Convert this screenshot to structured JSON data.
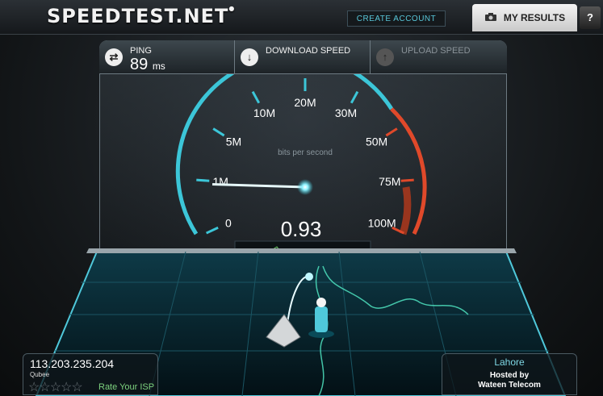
{
  "header": {
    "logo": "SPEEDTEST.NET",
    "create_account": "CREATE ACCOUNT",
    "my_results": "MY RESULTS",
    "help": "?"
  },
  "tabs": {
    "ping": {
      "label": "PING",
      "value": "89",
      "unit": "ms"
    },
    "download": {
      "label": "DOWNLOAD SPEED"
    },
    "upload": {
      "label": "UPLOAD SPEED"
    }
  },
  "gauge": {
    "unit_label": "bits per second",
    "value": "0.93",
    "ticks": [
      "0",
      "1M",
      "5M",
      "10M",
      "20M",
      "30M",
      "50M",
      "75M",
      "100M"
    ],
    "needle_position": 0.93
  },
  "isp": {
    "ip": "113.203.235.204",
    "name": "Qubee",
    "stars": "☆☆☆☆☆",
    "rate_label": "Rate Your ISP"
  },
  "server": {
    "city": "Lahore",
    "hosted_label": "Hosted by",
    "host": "Wateen Telecom"
  },
  "colors": {
    "accent": "#3cc6d8",
    "warning": "#e0492a",
    "rate": "#7ed37e"
  }
}
